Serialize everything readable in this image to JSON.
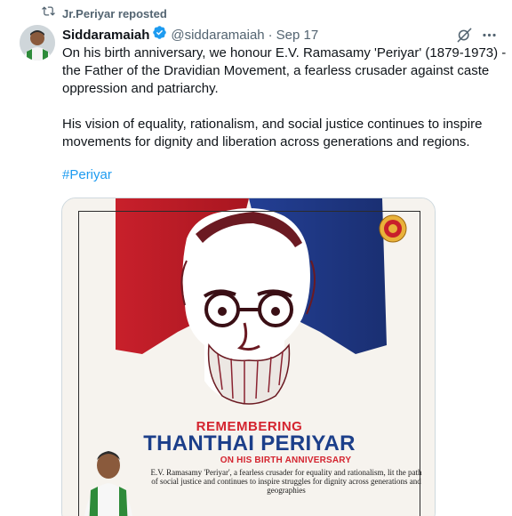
{
  "repost": {
    "label": "Jr.Periyar reposted",
    "icon": "repost-icon"
  },
  "tweet": {
    "author_name": "Siddaramaiah",
    "handle": "@siddaramaiah",
    "separator": "·",
    "date": "Sep 17",
    "paragraph1": "On his birth anniversary, we honour E.V. Ramasamy 'Periyar' (1879-1973) - the Father of the Dravidian Movement, a fearless crusader against caste oppression and patriarchy.",
    "paragraph2": "His vision of equality, rationalism, and social justice continues to inspire movements for dignity and liberation across generations and regions.",
    "hashtag": "#Periyar"
  },
  "poster": {
    "line1": "REMEMBERING",
    "line2": "THANTHAI PERIYAR",
    "line3": "ON HIS BIRTH ANNIVERSARY",
    "description": "E.V. Ramasamy 'Periyar', a fearless crusader for equality and rationalism, lit the path of social justice and continues to inspire struggles for dignity across generations and geographies"
  },
  "colors": {
    "link": "#1d9bf0",
    "muted": "#536471",
    "verified": "#1d9bf0",
    "poster_red": "#d4242f",
    "poster_blue": "#1c3f8a"
  },
  "icons": [
    "repost-icon",
    "verified-badge-icon",
    "grok-icon",
    "more-icon"
  ]
}
